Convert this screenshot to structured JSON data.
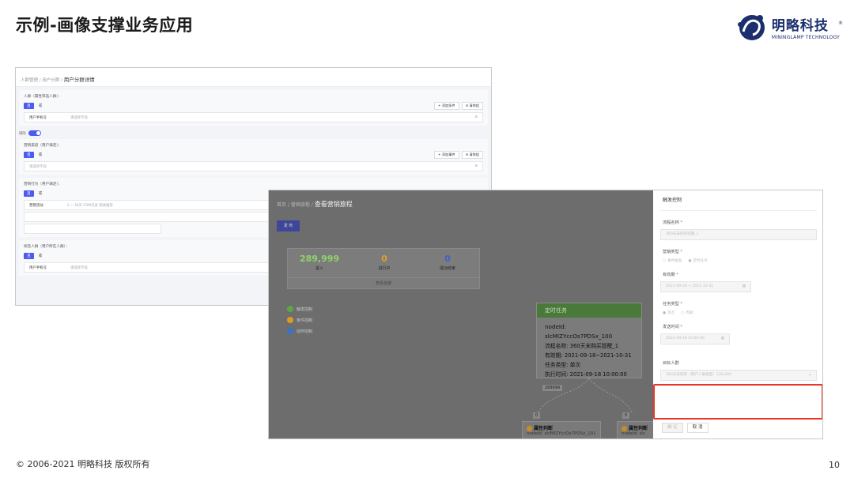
{
  "slide": {
    "title": "示例-画像支撑业务应用",
    "logo_cn": "明略科技",
    "logo_en": "MININGLAMP TECHNOLOGY",
    "logo_reg": "®",
    "footer": "© 2006-2021 明略科技 版权所有",
    "page": "10"
  },
  "segment_screen": {
    "breadcrumb": [
      "人群管理",
      "用户分群",
      "用户分群详情"
    ],
    "sections": [
      {
        "heading": "人群（属性筛选人群）：",
        "or_label": "或",
        "and_label": "且",
        "buttons": [
          "+ 添加条件",
          "⊘ 清除组"
        ],
        "row_field": "用户手机号",
        "row_placeholder": "请选择字段"
      },
      {
        "heading": "营销渠道（用户满足）：",
        "or_label": "或",
        "and_label": "且",
        "buttons": [
          "+ 添加事件",
          "⊘ 清除组"
        ],
        "row_field": "",
        "row_placeholder": "请选择字段"
      },
      {
        "heading": "营销行为（用户满足）：",
        "or_label": "或",
        "and_label": "且",
        "buttons": [],
        "row_field": "营销活动",
        "row_placeholder": "1  ~  30天   CRM记录   相关推荐"
      },
      {
        "heading": "标签人群（用户所在人群）：",
        "or_label": "或",
        "and_label": "且",
        "buttons": [],
        "row_field": "用户手机号",
        "row_placeholder": "请选择字段"
      }
    ],
    "toggle_label": "排除"
  },
  "journey_screen": {
    "breadcrumb": [
      "首页",
      "营销旅程",
      "查看营销旅程"
    ],
    "publish_label": "发 布",
    "stats": [
      {
        "value": "289,999",
        "label": "进入",
        "color": "#8fd46a"
      },
      {
        "value": "0",
        "label": "进行中",
        "color": "#e39c2a"
      },
      {
        "value": "0",
        "label": "成功结束",
        "color": "#3d63c8"
      }
    ],
    "view_all": "查看全部",
    "legend": [
      {
        "label": "触发控制",
        "color": "#5aa845"
      },
      {
        "label": "条件控制",
        "color": "#d99b21"
      },
      {
        "label": "动作控制",
        "color": "#3a72c4"
      }
    ],
    "node": {
      "header": "定时任务",
      "lines": [
        "nodeId: slcMIZYccOs7PDSx_100",
        "流程名称: 360天未购买提醒_1",
        "有效期: 2021-09-18~2021-10-31",
        "任务类型: 单次",
        "执行时间: 2021-09-18 10:00:00"
      ]
    },
    "count_tag": "289999",
    "zero_labels": [
      "0",
      "0"
    ],
    "child_nodes": [
      {
        "title": "属性判断",
        "sub": "nodeId: slcMIZYccOs7PDSx_101"
      },
      {
        "title": "属性判断",
        "sub": "nodeId: slc"
      }
    ]
  },
  "trigger_panel": {
    "title": "触发控制",
    "fields": [
      {
        "label": "流程名称",
        "required": true,
        "value": "360天未购买提醒_1"
      },
      {
        "label": "营销类型",
        "required": true,
        "options": [
          "事件触发",
          "定时任务"
        ]
      },
      {
        "label": "有效期",
        "required": true,
        "value": "2021-09-18   →   2021-10-31"
      },
      {
        "label": "任务类型",
        "required": true,
        "options": [
          "单次",
          "周期"
        ]
      },
      {
        "label": "发送时间",
        "required": true,
        "value": "2021-09-18 10:00:00"
      },
      {
        "label": "目标人群",
        "required": false,
        "value": "360天未购买（用户人群类型）120,000"
      }
    ],
    "buttons": [
      "确 定",
      "取 消"
    ],
    "highlight_color": "#e8382a"
  }
}
